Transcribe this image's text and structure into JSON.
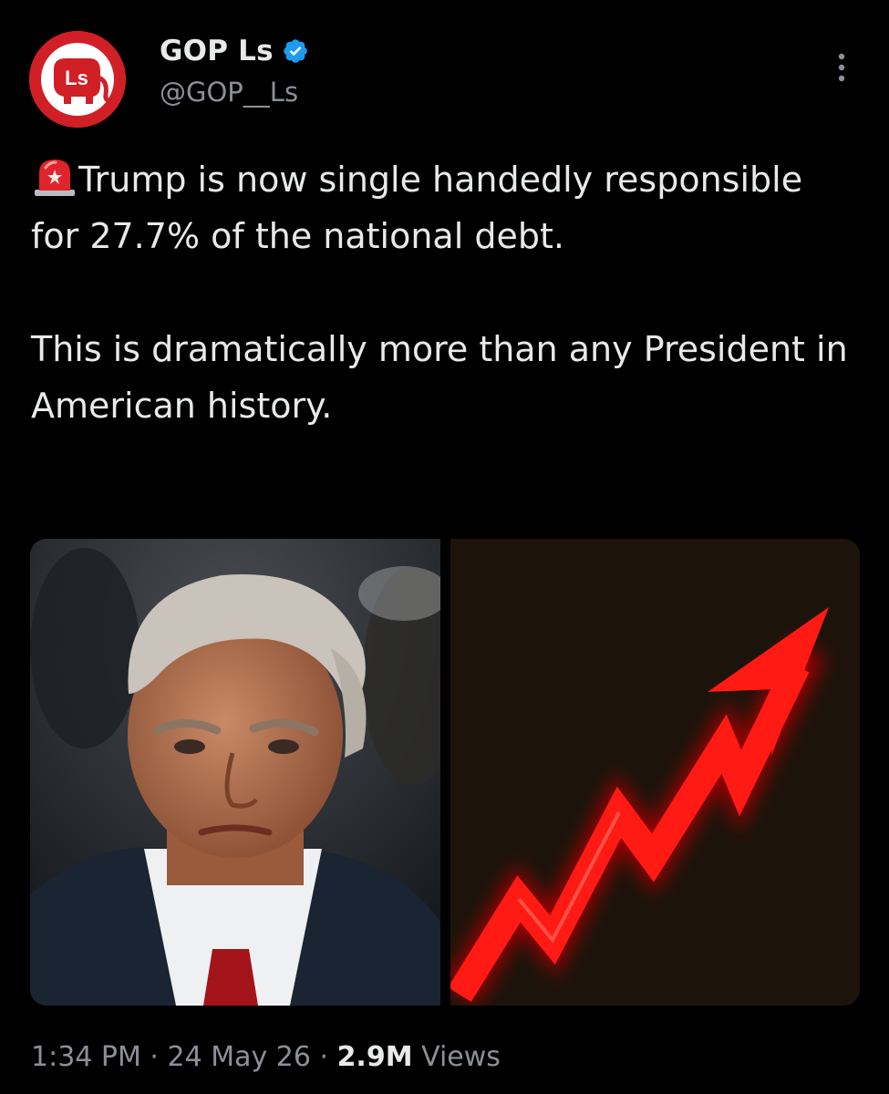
{
  "account": {
    "display_name": "GOP Ls",
    "handle": "@GOP__Ls",
    "verified": true,
    "avatar_text": "Ls",
    "avatar_color": "#d11f26",
    "verified_color": "#1d9bf0"
  },
  "menu": {
    "icon": "more-vertical-icon"
  },
  "tweet": {
    "emoji_icon": "siren-icon",
    "line1": "Trump is now single handedly responsible for 27.7% of the national debt.",
    "line2": "This is dramatically more than any President in American history."
  },
  "media": [
    {
      "kind": "photo"
    },
    {
      "kind": "graphic",
      "icon": "rising-arrow-icon",
      "arrow_color": "#ff1a14"
    }
  ],
  "meta": {
    "time": "1:34 PM",
    "separator": " · ",
    "date": "24 May 26",
    "views_count": "2.9M",
    "views_label": " Views"
  }
}
